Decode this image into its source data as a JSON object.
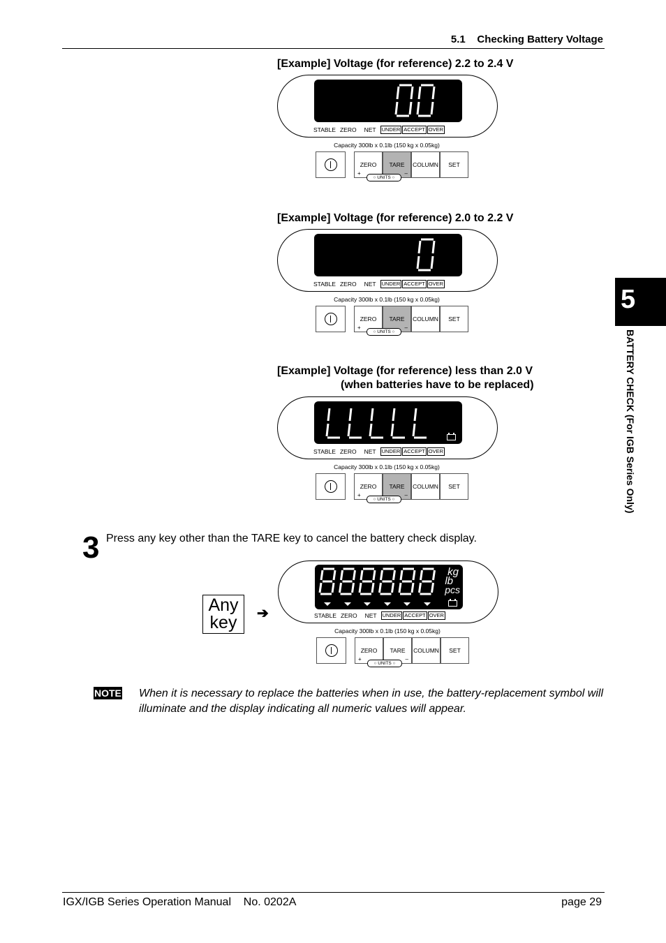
{
  "header": {
    "section_title": "5.1    Checking Battery Voltage"
  },
  "examples": [
    {
      "caption": "[Example] Voltage (for reference) 2.2 to 2.4 V",
      "display": "00",
      "battery_icon": false
    },
    {
      "caption": "[Example] Voltage (for reference) 2.0 to 2.2 V",
      "display": "0",
      "battery_icon": false
    },
    {
      "caption": "[Example]  Voltage (for reference) less than 2.0 V",
      "caption_line2": "(when batteries have to be replaced)",
      "display": "LLLLL",
      "battery_icon": true
    }
  ],
  "panel": {
    "annunciators": [
      "STABLE",
      "ZERO",
      "NET"
    ],
    "boxed_annunciators": [
      "UNDER",
      "ACCEPT",
      "OVER"
    ],
    "capacity": "Capacity 300lb x 0.1lb (150 kg x 0.05kg)",
    "keys": {
      "zero": "ZERO",
      "tare": "TARE",
      "column": "COLUMN",
      "set": "SET",
      "plus": "+",
      "minus": "–",
      "units": "○ UNITS ○"
    },
    "units_labels": [
      "kg",
      "lb",
      "pcs"
    ],
    "all_segments_display": "8,8,8,8,8,8"
  },
  "step3": {
    "number": "3",
    "text": "Press any key other than the TARE key to cancel the battery check display.",
    "any_key_line1": "Any",
    "any_key_line2": "key",
    "arrow": "➔"
  },
  "note": {
    "badge": "NOTE",
    "text": "When it is necessary to replace the batteries when in use, the battery-replacement symbol will illuminate and the display indicating all numeric values will appear."
  },
  "side_tab": {
    "number": "5",
    "label": "BATTERY CHECK (For IGB Series Only)"
  },
  "footer": {
    "left": "IGX/IGB Series Operation Manual    No. 0202A",
    "right": "page 29"
  }
}
